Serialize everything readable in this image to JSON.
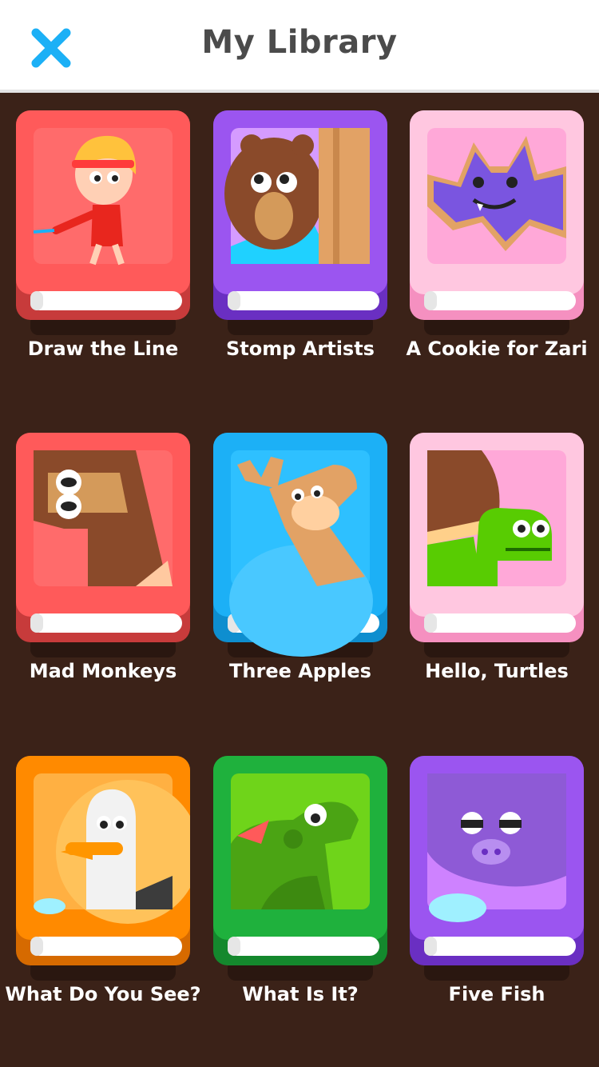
{
  "header": {
    "title": "My Library",
    "close_icon": "close-icon"
  },
  "colors": {
    "background": "#3b2218",
    "header_bg": "#ffffff",
    "close_icon": "#1cb0f6",
    "title": "#4b4b4b"
  },
  "books": [
    {
      "title": "Draw the Line",
      "cover_color": "#e94a4a",
      "art": "boy-with-pencil"
    },
    {
      "title": "Stomp Artists",
      "cover_color": "#8a46e0",
      "art": "brown-bear"
    },
    {
      "title": "A Cookie for Zari",
      "cover_color": "#ffb3d4",
      "art": "bat-cookie"
    },
    {
      "title": "Mad Monkeys",
      "cover_color": "#e94a4a",
      "art": "monkey"
    },
    {
      "title": "Three Apples",
      "cover_color": "#1cb0f6",
      "art": "llama"
    },
    {
      "title": "Hello, Turtles",
      "cover_color": "#ffb3d4",
      "art": "turtle"
    },
    {
      "title": "What Do You See?",
      "cover_color": "#ff8a00",
      "art": "seagull"
    },
    {
      "title": "What Is It?",
      "cover_color": "#1fb13d",
      "art": "iguana"
    },
    {
      "title": "Five Fish",
      "cover_color": "#8a46e0",
      "art": "hippo"
    }
  ]
}
